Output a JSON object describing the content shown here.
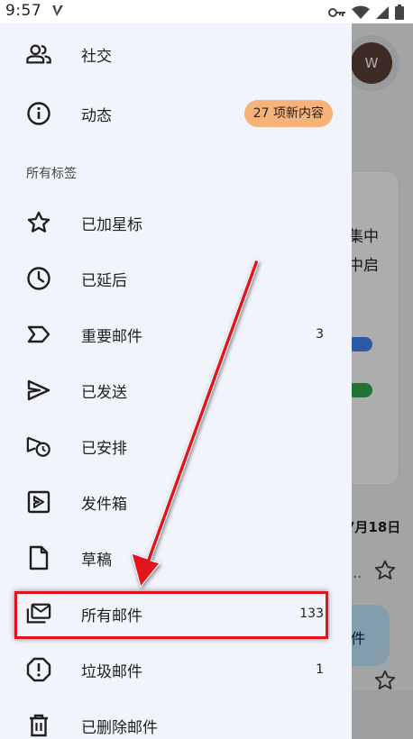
{
  "status_bar": {
    "time": "9:57",
    "icons": [
      "v-notification-icon",
      "key-icon",
      "wifi-icon",
      "cellular-signal-icon",
      "battery-icon"
    ]
  },
  "background": {
    "avatar_initial": "W",
    "card_text_line1": "集中",
    "card_text_line2": "中启",
    "date": "7月18日",
    "ellipsis": "...",
    "compose_fragment": "件"
  },
  "drawer": {
    "items_top": [
      {
        "key": "social",
        "label": "社交",
        "icon": "people-icon"
      },
      {
        "key": "updates",
        "label": "动态",
        "icon": "info-icon",
        "badge": "27 项新内容"
      }
    ],
    "section_header": "所有标签",
    "items": [
      {
        "key": "starred",
        "label": "已加星标",
        "icon": "star-icon",
        "count": ""
      },
      {
        "key": "snoozed",
        "label": "已延后",
        "icon": "clock-icon",
        "count": ""
      },
      {
        "key": "important",
        "label": "重要邮件",
        "icon": "important-label-icon",
        "count": "3"
      },
      {
        "key": "sent",
        "label": "已发送",
        "icon": "send-icon",
        "count": ""
      },
      {
        "key": "scheduled",
        "label": "已安排",
        "icon": "scheduled-send-icon",
        "count": ""
      },
      {
        "key": "outbox",
        "label": "发件箱",
        "icon": "outbox-icon",
        "count": ""
      },
      {
        "key": "drafts",
        "label": "草稿",
        "icon": "draft-icon",
        "count": ""
      },
      {
        "key": "all_mail",
        "label": "所有邮件",
        "icon": "all-mail-icon",
        "count": "133"
      },
      {
        "key": "spam",
        "label": "垃圾邮件",
        "icon": "spam-icon",
        "count": "1"
      },
      {
        "key": "trash",
        "label": "已删除邮件",
        "icon": "trash-icon",
        "count": ""
      }
    ]
  },
  "colors": {
    "drawer_bg": "#f1f4fb",
    "badge_bg": "#f7b27a",
    "highlight": "#e0141e"
  }
}
